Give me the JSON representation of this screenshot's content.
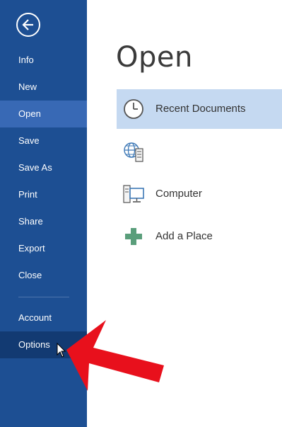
{
  "sidebar": {
    "back_icon": "back-arrow-icon",
    "items": [
      {
        "label": "Info"
      },
      {
        "label": "New"
      },
      {
        "label": "Open"
      },
      {
        "label": "Save"
      },
      {
        "label": "Save As"
      },
      {
        "label": "Print"
      },
      {
        "label": "Share"
      },
      {
        "label": "Export"
      },
      {
        "label": "Close"
      },
      {
        "label": "Account"
      },
      {
        "label": "Options"
      }
    ],
    "selected": "Open",
    "hovered": "Options"
  },
  "main": {
    "title": "Open",
    "places": [
      {
        "label": "Recent Documents",
        "icon": "clock-icon"
      },
      {
        "label": "",
        "icon": "globe-server-icon"
      },
      {
        "label": "Computer",
        "icon": "computer-icon"
      },
      {
        "label": "Add a Place",
        "icon": "plus-icon"
      }
    ]
  },
  "colors": {
    "sidebar": "#1d4f93",
    "sidebar_selected": "#3869b5",
    "sidebar_hover": "#123a72",
    "place_selected": "#c5d9f1",
    "annotation_arrow": "#e8101c",
    "plus_icon": "#5a9e7b"
  }
}
